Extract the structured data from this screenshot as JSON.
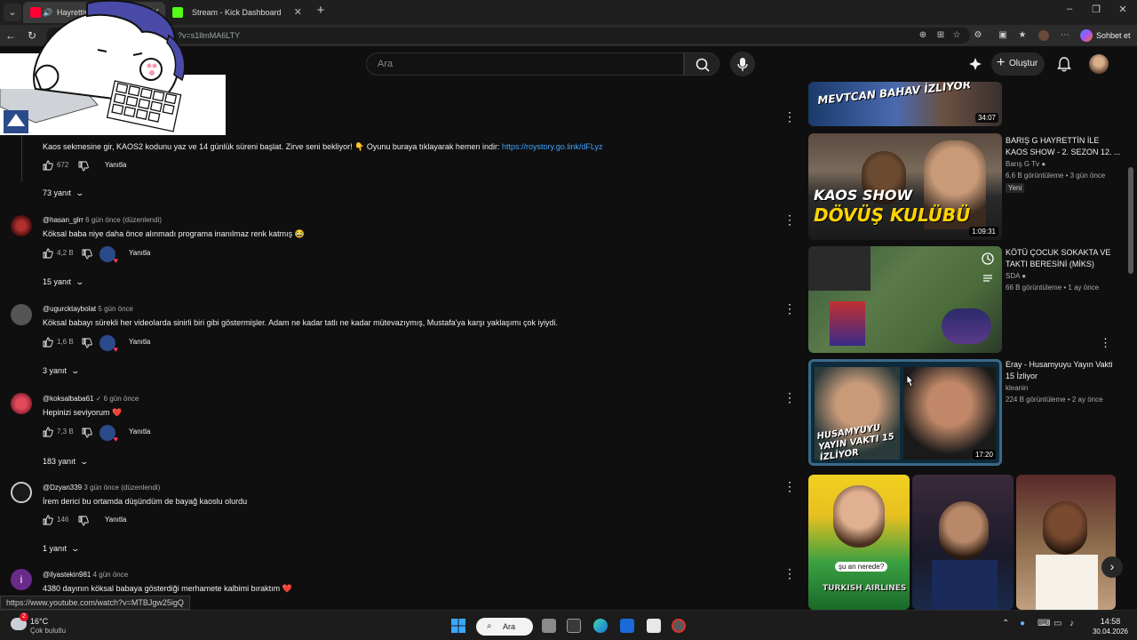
{
  "browser": {
    "tabs": [
      {
        "label": "Hayrettin",
        "active": true
      },
      {
        "label": "Stream - Kick Dashboard",
        "active": false
      }
    ],
    "url": "?v=s1llmMA6LTY",
    "copilot_label": "Sohbet et"
  },
  "header": {
    "search_placeholder": "Ara",
    "create_label": "Oluştur"
  },
  "comments": [
    {
      "text": "Kaos sekmesine gir, KAOS2 kodunu yaz ve 14 günlük süreni başlat. Zirve seni bekliyor! 👇 Oyunu buraya tıklayarak hemen indir: ",
      "link": "https://roystory.go.link/dFLyz",
      "likes": "672",
      "reply_label": "Yanıtla",
      "replies_label": "73 yanıt"
    },
    {
      "author": "@hasan_glrr",
      "time": "6 gün önce (düzenlendi)",
      "text": "Köksal baba niye daha önce alınmadı programa inanılmaz renk katmış 😂",
      "likes": "4,2 B",
      "reply_label": "Yanıtla",
      "replies_label": "15 yanıt"
    },
    {
      "author": "@ugurcktaybolat",
      "time": "5 gün önce",
      "text": "Köksal babayı sürekli her videolarda sinirli biri gibi göstermişler. Adam ne kadar tatlı ne kadar mütevazıymış, Mustafa'ya karşı yaklaşımı çok iyiydi.",
      "likes": "1,6 B",
      "reply_label": "Yanıtla",
      "replies_label": "3 yanıt"
    },
    {
      "author": "@koksalbaba61",
      "verified": "✓",
      "time": "6 gün önce",
      "text": "Hepinizi seviyorum ❤️",
      "likes": "7,3 B",
      "reply_label": "Yanıtla",
      "replies_label": "183 yanıt"
    },
    {
      "author": "@Dzyan339",
      "time": "3 gün önce (düzenlendi)",
      "text": "İrem derici bu ortamda düşündüm de bayağ kaoslu olurdu",
      "likes": "146",
      "reply_label": "Yanıtla",
      "replies_label": "1 yanıt"
    },
    {
      "author": "@ilyastekin981",
      "time": "4 gün önce",
      "avatar_letter": "i",
      "text": "4380 dayının köksal babaya gösterdiği merhamete kalbimi bıraktım ❤️"
    }
  ],
  "sidebar": {
    "videos": [
      {
        "thumb_text": "MEVTCAN BAHAV İZLİYOR",
        "duration": "34:07"
      },
      {
        "title": "BARIŞ G HAYRETTİN İLE KAOS SHOW - 2. SEZON 12. ...",
        "channel": "Barış G Tv",
        "meta": "6,6 B görüntüleme • 3 gün önce",
        "badge": "Yeni",
        "thumb_text_1": "KAOS SHOW",
        "thumb_text_2": "DÖVÜŞ KULÜBÜ",
        "duration": "1:09:31"
      },
      {
        "title": "KÖTÜ ÇOCUK SOKAKTA VE TAKTI BERESİNİ (MİKS)",
        "channel": "SDA",
        "meta": "66 B görüntüleme • 1 ay önce"
      },
      {
        "title": "Eray - Husamyuyu Yayın Vakti 15 İzliyor",
        "channel": "kleanin",
        "meta": "224 B görüntüleme • 2 ay önce",
        "thumb_text": "HUSAMYUYU YAYIN VAKTI 15 İZLİYOR",
        "duration": "17:20"
      }
    ],
    "shorts": [
      {
        "caption": "şu an nerede?",
        "jersey": "TURKISH AIRLINES"
      },
      {},
      {}
    ]
  },
  "status_url": "https://www.youtube.com/watch?v=MTBJgw25igQ",
  "taskbar": {
    "temperature": "16°C",
    "weather": "Çok bulutlu",
    "search_label": "Ara",
    "time": "14:58",
    "date": "30.04.2026",
    "notification_count": "2"
  },
  "colors": {
    "background": "#0f0f0f",
    "link": "#3ea6ff",
    "youtube_red": "#ff0033",
    "kick_green": "#53fc18"
  }
}
